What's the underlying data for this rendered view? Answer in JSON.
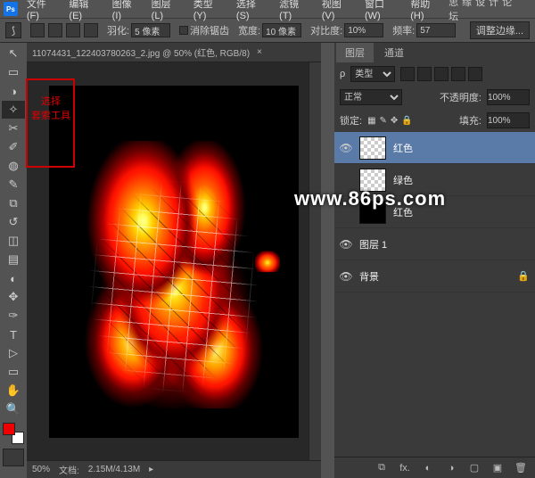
{
  "menubar": {
    "items": [
      "文件(F)",
      "编辑(E)",
      "图像(I)",
      "图层(L)",
      "类型(Y)",
      "选择(S)",
      "滤镜(T)",
      "视图(V)",
      "窗口(W)",
      "帮助(H)"
    ],
    "rightlabel": "思缘设计论坛"
  },
  "optionsbar": {
    "feather_label": "羽化:",
    "feather_value": "5 像素",
    "antialias_label": "消除锯齿",
    "width_label": "宽度:",
    "width_value": "10 像素",
    "contrast_label": "对比度:",
    "contrast_value": "10%",
    "frequency_label": "频率:",
    "frequency_value": "57",
    "adjust_edge": "调整边缘..."
  },
  "doc": {
    "tab": "11074431_122403780263_2.jpg @ 50% (红色, RGB/8)",
    "zoom": "50%",
    "docsize_label": "文档:",
    "docsize": "2.15M/4.13M"
  },
  "redbox": {
    "line1": "选择",
    "line2": "套索工具"
  },
  "layers_panel": {
    "tab1": "图层",
    "tab2": "通道",
    "kind_label": "类型",
    "blend": "正常",
    "opacity_label": "不透明度:",
    "opacity_value": "100%",
    "lock_label": "锁定:",
    "fill_label": "填充:",
    "fill_value": "100%",
    "layers": [
      {
        "name": "红色",
        "thumb": "checker",
        "selected": true
      },
      {
        "name": "绿色",
        "thumb": "checker",
        "selected": false
      },
      {
        "name": "红色",
        "thumb": "black",
        "selected": false
      },
      {
        "name": "图层 1",
        "thumb": "fire",
        "selected": false
      },
      {
        "name": "背景",
        "thumb": "fire",
        "selected": false,
        "locked": true
      }
    ]
  },
  "watermark": "www.86ps.com",
  "tools": [
    "↖",
    "▭",
    "◑",
    "✎",
    "➴",
    "✂",
    "✐",
    "◌",
    "⧉",
    "✎",
    "▤",
    "⬚",
    "◐",
    "✥",
    "◈",
    "✋",
    "T",
    "▷",
    "▭",
    "◔",
    "⬡",
    "Q"
  ]
}
